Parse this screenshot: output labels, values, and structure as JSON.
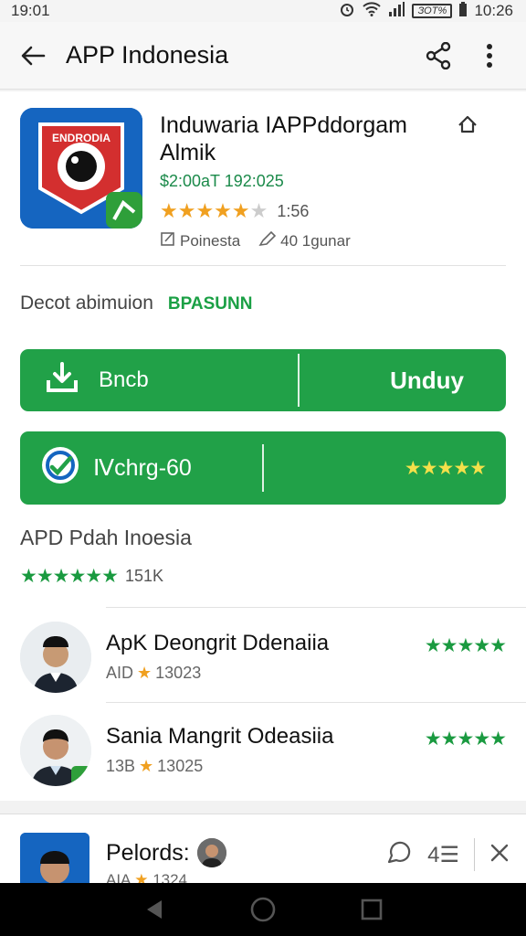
{
  "status": {
    "time": "19:01",
    "battery": "ЗОТ%",
    "clock": "10:26"
  },
  "appbar": {
    "title": "APP Indonesia"
  },
  "app": {
    "name": "Induwaria IAPPddorgam Almik",
    "icon_text": "ENDRODIA",
    "meta": "$2:00aT 192:025",
    "rating_count": "1:56",
    "publisher": "Poinesta",
    "users": "40 1gunar"
  },
  "description": {
    "label": "Decot abimuion",
    "accent": "BPASUNN"
  },
  "download_button": {
    "left": "Bncb",
    "right": "Unduy"
  },
  "update_button": {
    "label": "Ⅳchrg-60",
    "stars": "★★★★★"
  },
  "section": {
    "title": "APD Pdah Inoesia",
    "stars": "★★★★★★",
    "count": "151K"
  },
  "reviews": [
    {
      "name": "ApK Deongrit Ddenaiia",
      "sub_prefix": "AID",
      "sub_value": "13023",
      "stars": "★★★★★"
    },
    {
      "name": "Sania Mangrit Odeasiia",
      "sub_prefix": "13B",
      "sub_value": "13025",
      "stars": "★★★★★"
    }
  ],
  "bottom": {
    "title": "Pelords:",
    "sub_prefix": "AIA",
    "sub_value": "1324",
    "count": "4☰"
  },
  "colors": {
    "accent_green": "#21a148",
    "star_orange": "#f0a020",
    "star_green": "#1a9a40"
  },
  "icons": [
    "back-arrow-icon",
    "share-icon",
    "more-vert-icon",
    "home-icon",
    "download-icon",
    "update-icon",
    "close-icon",
    "back-nav-icon",
    "home-nav-icon",
    "recents-nav-icon"
  ]
}
